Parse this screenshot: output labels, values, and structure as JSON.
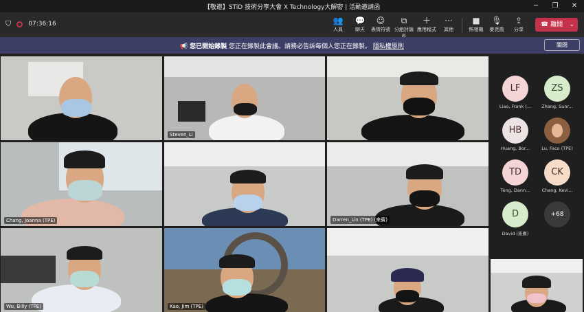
{
  "window": {
    "title": "【敬邀】STiD 技術分享大會 X Technology大解密 | 活動邀請函"
  },
  "toolbar": {
    "timer": "07:36:16",
    "buttons": [
      {
        "label": "人員",
        "icon": "people-icon"
      },
      {
        "label": "聊天",
        "icon": "chat-icon"
      },
      {
        "label": "表情符號",
        "icon": "reactions-icon"
      },
      {
        "label": "分組討論區",
        "icon": "breakout-icon"
      },
      {
        "label": "應用程式",
        "icon": "apps-icon"
      },
      {
        "label": "其他",
        "icon": "more-icon"
      },
      {
        "label": "照相機",
        "icon": "camera-icon"
      },
      {
        "label": "麥克風",
        "icon": "mic-icon"
      },
      {
        "label": "分享",
        "icon": "share-icon"
      }
    ],
    "leave_label": "離開"
  },
  "banner": {
    "title": "您已開始錄製",
    "message": "您正在錄製此會議。請務必告訴每個人您正在錄製。",
    "link": "隱私權原則",
    "close_label": "關閉"
  },
  "tiles": [
    {
      "label": ""
    },
    {
      "label": "Steven_Li"
    },
    {
      "label": ""
    },
    {
      "label": "Chang, Joanna (TPE)"
    },
    {
      "label": ""
    },
    {
      "label": "Darren_Lin (TPE) (來賓)"
    },
    {
      "label": "Wu, Billy (TPE)"
    },
    {
      "label": "Kao, Jim (TPE)"
    },
    {
      "label": ""
    }
  ],
  "participants": [
    {
      "initials": "LF",
      "name": "Liao, Frank (...",
      "color": "#f4d4d4"
    },
    {
      "initials": "ZS",
      "name": "Zhang, Sunr...",
      "color": "#d6eccc"
    },
    {
      "initials": "HB",
      "name": "Huang, Bor...",
      "color": "#ece4e4"
    },
    {
      "initials": "",
      "name": "Lu, Faco (TPE)",
      "color": "#8a6040"
    },
    {
      "initials": "TD",
      "name": "Teng, Dann...",
      "color": "#f4d4d4"
    },
    {
      "initials": "CK",
      "name": "Chang, Kevi...",
      "color": "#f6dcc8"
    },
    {
      "initials": "D",
      "name": "David (來賓)",
      "color": "#d6eccc"
    },
    {
      "initials": "+68",
      "name": "",
      "color": "#3a3a3a"
    }
  ]
}
